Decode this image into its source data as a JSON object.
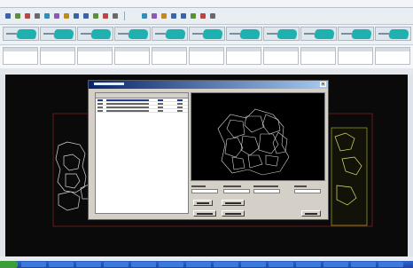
{
  "window": {
    "title": "",
    "colors": {
      "toolbar_bg": "#e9eef3",
      "thumb_accent": "#1fb1b0",
      "canvas_bg": "#0a0a0a",
      "dialog_title_start": "#0a246a",
      "dialog_title_end": "#a6caf0",
      "taskbar": "#1c45a6"
    }
  },
  "toolbar": {
    "icons": [
      "save-icon",
      "open-icon",
      "print-icon",
      "cut-icon",
      "copy-icon",
      "paste-icon",
      "undo-icon",
      "redo-icon",
      "zoom-in-icon",
      "zoom-out-icon",
      "pan-icon",
      "select-icon",
      "draw-icon",
      "layer-icon",
      "grid-icon",
      "measure-icon",
      "rotate-icon",
      "mirror-icon",
      "settings-icon",
      "help-icon"
    ]
  },
  "pattern_strip": {
    "thumbnail_count": 11
  },
  "piece_table": {
    "column_count": 11
  },
  "dialog": {
    "title": "",
    "close_glyph": "×",
    "list": {
      "row_count": 4,
      "selected_row": 0
    },
    "buttons": [
      "",
      "",
      "",
      "",
      ""
    ]
  },
  "taskbar": {
    "button_count": 14
  }
}
